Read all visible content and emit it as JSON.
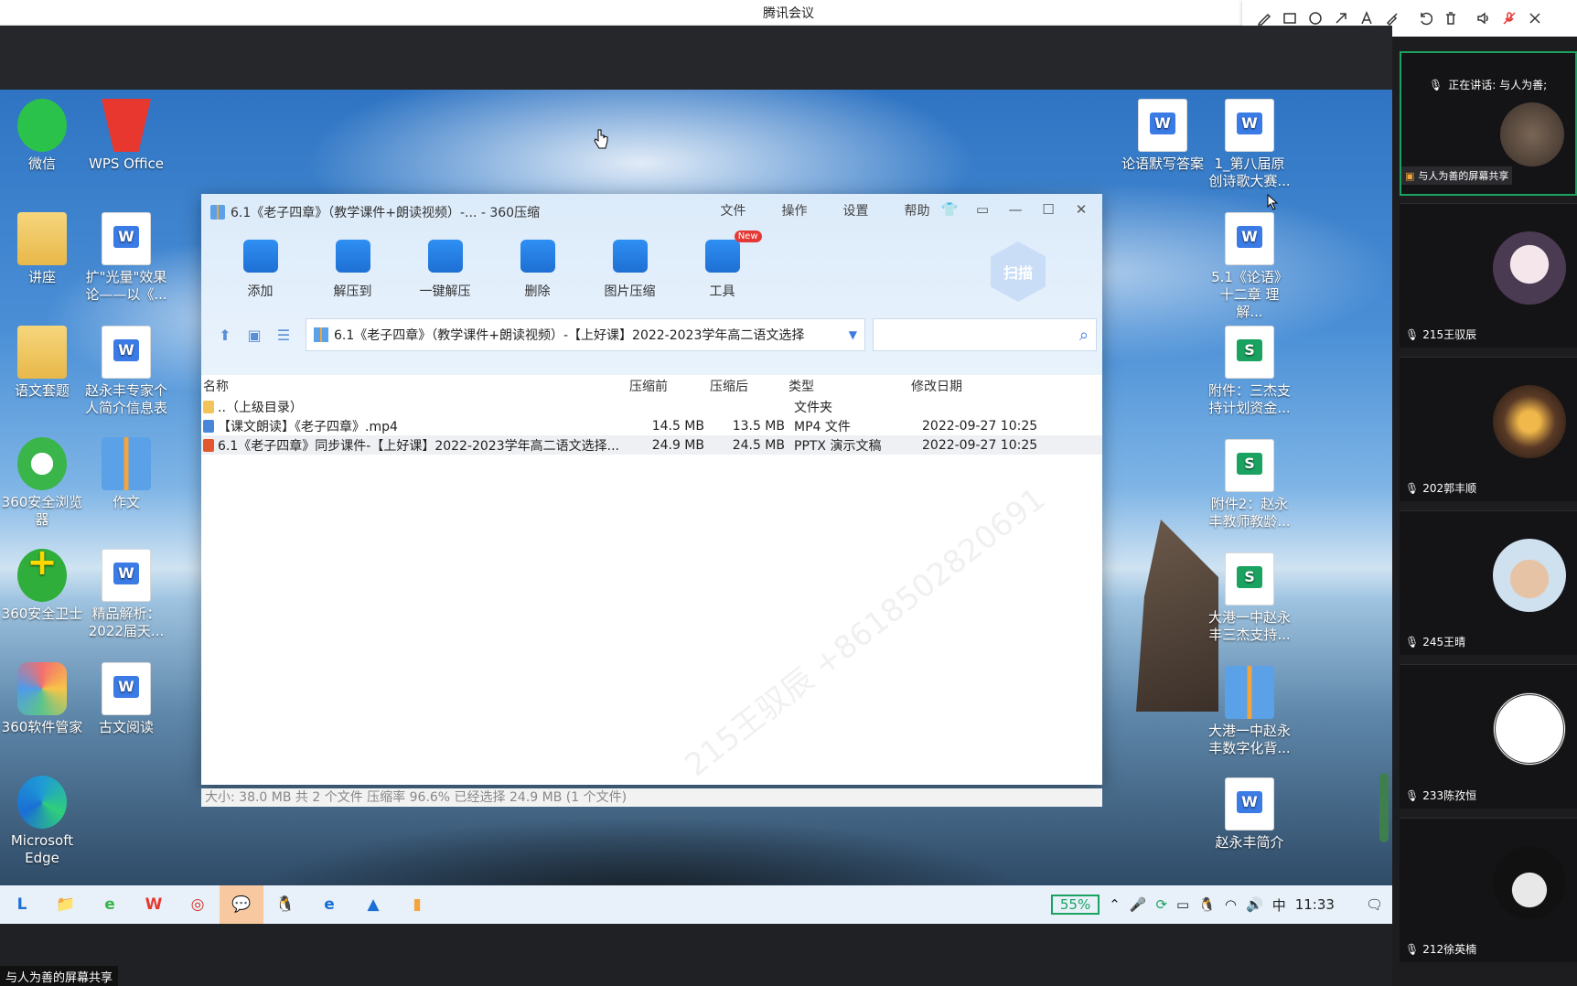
{
  "app": {
    "title": "腾讯会议"
  },
  "annotation_tools": [
    "pen-icon",
    "rectangle-icon",
    "circle-icon",
    "arrow-icon",
    "text-icon",
    "highlighter-icon",
    "undo-icon",
    "delete-icon",
    "speaker-icon",
    "mic-muted-icon",
    "close-icon"
  ],
  "desktop": {
    "left_icons": [
      {
        "label": "微信",
        "type": "wechat"
      },
      {
        "label": "WPS Office",
        "type": "wps"
      },
      {
        "label": "讲座",
        "type": "folder"
      },
      {
        "label": "扩\"光量\"效果论——以《...",
        "type": "doc-w"
      },
      {
        "label": "语文套题",
        "type": "folder"
      },
      {
        "label": "赵永丰专家个人简介信息表",
        "type": "doc-w"
      },
      {
        "label": "360安全浏览器",
        "type": "ie360"
      },
      {
        "label": "作文",
        "type": "zip"
      },
      {
        "label": "360安全卫士",
        "type": "guard"
      },
      {
        "label": "精品解析：2022届天...",
        "type": "doc-w"
      },
      {
        "label": "360软件管家",
        "type": "soft"
      },
      {
        "label": "古文阅读",
        "type": "doc-w"
      },
      {
        "label": "Microsoft Edge",
        "type": "edge"
      }
    ],
    "right_icons": [
      {
        "label": "论语默写答案",
        "type": "doc-w"
      },
      {
        "label": "1_第八届原创诗歌大赛...",
        "type": "doc-w"
      },
      {
        "label": "5.1《论语》十二章 理解...",
        "type": "doc-w"
      },
      {
        "label": "附件：三杰支持计划资金...",
        "type": "doc-s"
      },
      {
        "label": "附件2：赵永丰教师教龄...",
        "type": "doc-s"
      },
      {
        "label": "大港一中赵永丰三杰支持...",
        "type": "doc-s"
      },
      {
        "label": "大港一中赵永丰数字化背...",
        "type": "zip"
      },
      {
        "label": "赵永丰简介",
        "type": "doc-w"
      }
    ]
  },
  "zipwin": {
    "title": "6.1《老子四章》（教学课件+朗读视频）-... - 360压缩",
    "menu": [
      "文件",
      "操作",
      "设置",
      "帮助"
    ],
    "tools": [
      "添加",
      "解压到",
      "一键解压",
      "删除",
      "图片压缩",
      "工具"
    ],
    "new_badge": "New",
    "scan_label": "扫描",
    "path": "6.1《老子四章》（教学课件+朗读视频）-【上好课】2022-2023学年高二语文选择",
    "columns": [
      "名称",
      "压缩前",
      "压缩后",
      "类型",
      "修改日期"
    ],
    "rows": [
      {
        "name": "..（上级目录）",
        "pre": "",
        "post": "",
        "type": "文件夹",
        "date": ""
      },
      {
        "name": "【课文朗读】《老子四章》.mp4",
        "pre": "14.5 MB",
        "post": "13.5 MB",
        "type": "MP4 文件",
        "date": "2022-09-27 10:25"
      },
      {
        "name": "6.1《老子四章》同步课件-【上好课】2022-2023学年高二语文选择...",
        "pre": "24.9 MB",
        "post": "24.5 MB",
        "type": "PPTX 演示文稿",
        "date": "2022-09-27 10:25"
      }
    ],
    "status": "大小: 38.0 MB 共 2 个文件 压缩率 96.6% 已经选择 24.9 MB (1 个文件)",
    "watermark": "215王驭辰 +8618502820691"
  },
  "taskbar": {
    "apps": [
      "L",
      "📁",
      "e",
      "W",
      "◎",
      "💬",
      "🐧",
      "e",
      "▲",
      "▮"
    ],
    "battery": "55%",
    "ime": "中",
    "time": "11:33"
  },
  "share_label": "与人为善的屏幕共享",
  "panel": {
    "speaking": "正在讲话: 与人为善;",
    "sharer_tag": "与人为善的屏幕共享",
    "participants": [
      "215王驭辰",
      "202郭丰顺",
      "245王晴",
      "233陈孜恒",
      "212徐英楠"
    ]
  },
  "colors": {
    "accent": "#1aa260",
    "blue": "#3b7be5"
  }
}
